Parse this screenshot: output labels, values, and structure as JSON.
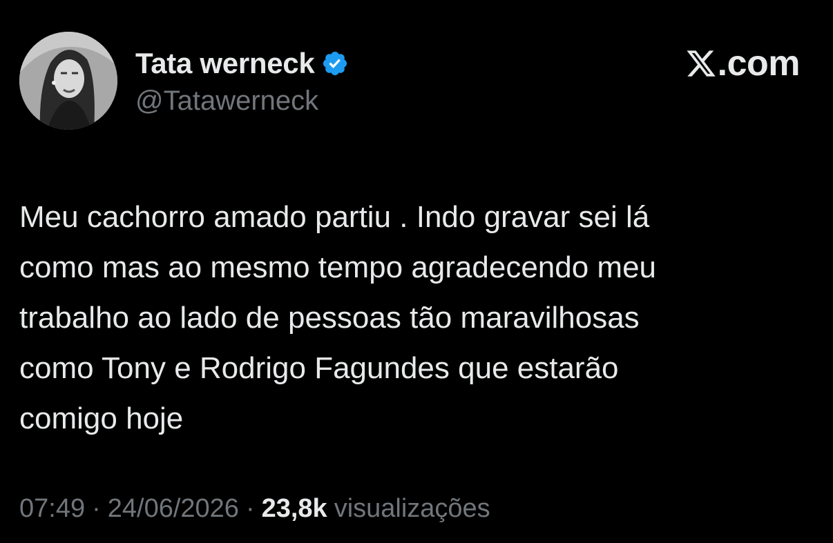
{
  "author": {
    "display_name": "Tata werneck",
    "handle": "@Tatawerneck",
    "verified": true,
    "avatar_icon": "profile-photo-avatar"
  },
  "brand": {
    "logo_icon": "x-logo-icon",
    "text": ".com"
  },
  "tweet": {
    "text": "Meu cachorro amado partiu . Indo gravar sei lá\ncomo mas ao mesmo tempo agradecendo meu\ntrabalho ao lado de pessoas tão maravilhosas\ncomo Tony e Rodrigo Fagundes que estarão\ncomigo hoje"
  },
  "meta": {
    "time": "07:49",
    "date": "24/06/2026",
    "separator": "·",
    "views_count": "23,8k",
    "views_label": "visualizações"
  },
  "colors": {
    "background": "#000000",
    "primary_text": "#e7e9ea",
    "secondary_text": "#71767b",
    "verified_badge": "#1d9bf0"
  }
}
